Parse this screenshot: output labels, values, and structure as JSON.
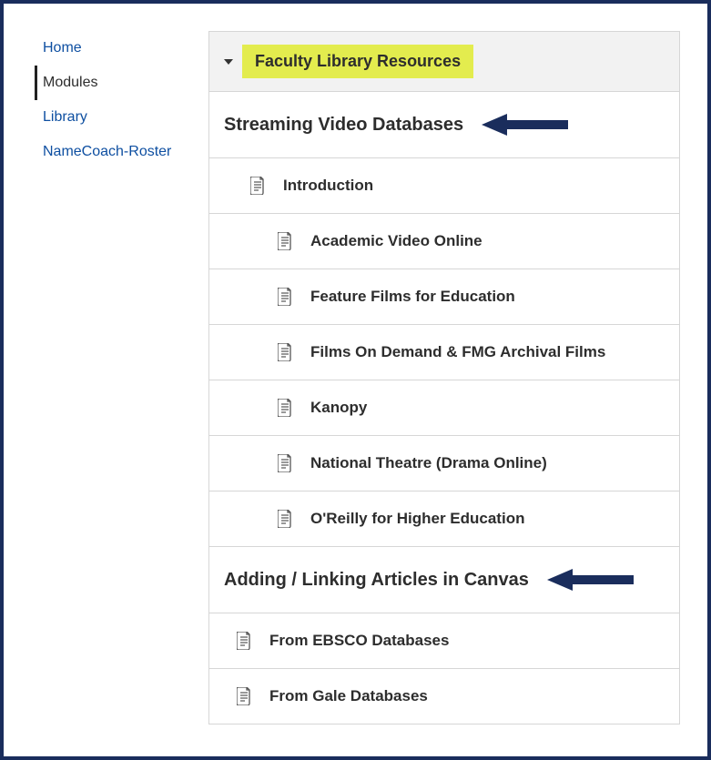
{
  "sidebar": {
    "items": [
      {
        "label": "Home",
        "active": false
      },
      {
        "label": "Modules",
        "active": true
      },
      {
        "label": "Library",
        "active": false
      },
      {
        "label": "NameCoach-Roster",
        "active": false
      }
    ]
  },
  "module": {
    "title": "Faculty Library Resources",
    "sections": [
      {
        "title": "Streaming Video Databases",
        "arrow": true,
        "items": [
          {
            "label": "Introduction",
            "indent": 1
          },
          {
            "label": "Academic Video Online",
            "indent": 2
          },
          {
            "label": "Feature Films for Education",
            "indent": 2
          },
          {
            "label": "Films On Demand & FMG Archival Films",
            "indent": 2
          },
          {
            "label": "Kanopy",
            "indent": 2
          },
          {
            "label": "National Theatre (Drama Online)",
            "indent": 2
          },
          {
            "label": "O'Reilly for Higher Education",
            "indent": 2
          }
        ]
      },
      {
        "title": "Adding / Linking Articles in Canvas",
        "arrow": true,
        "items": [
          {
            "label": "From EBSCO Databases",
            "indent": 0
          },
          {
            "label": "From Gale Databases",
            "indent": 0
          }
        ]
      }
    ]
  }
}
